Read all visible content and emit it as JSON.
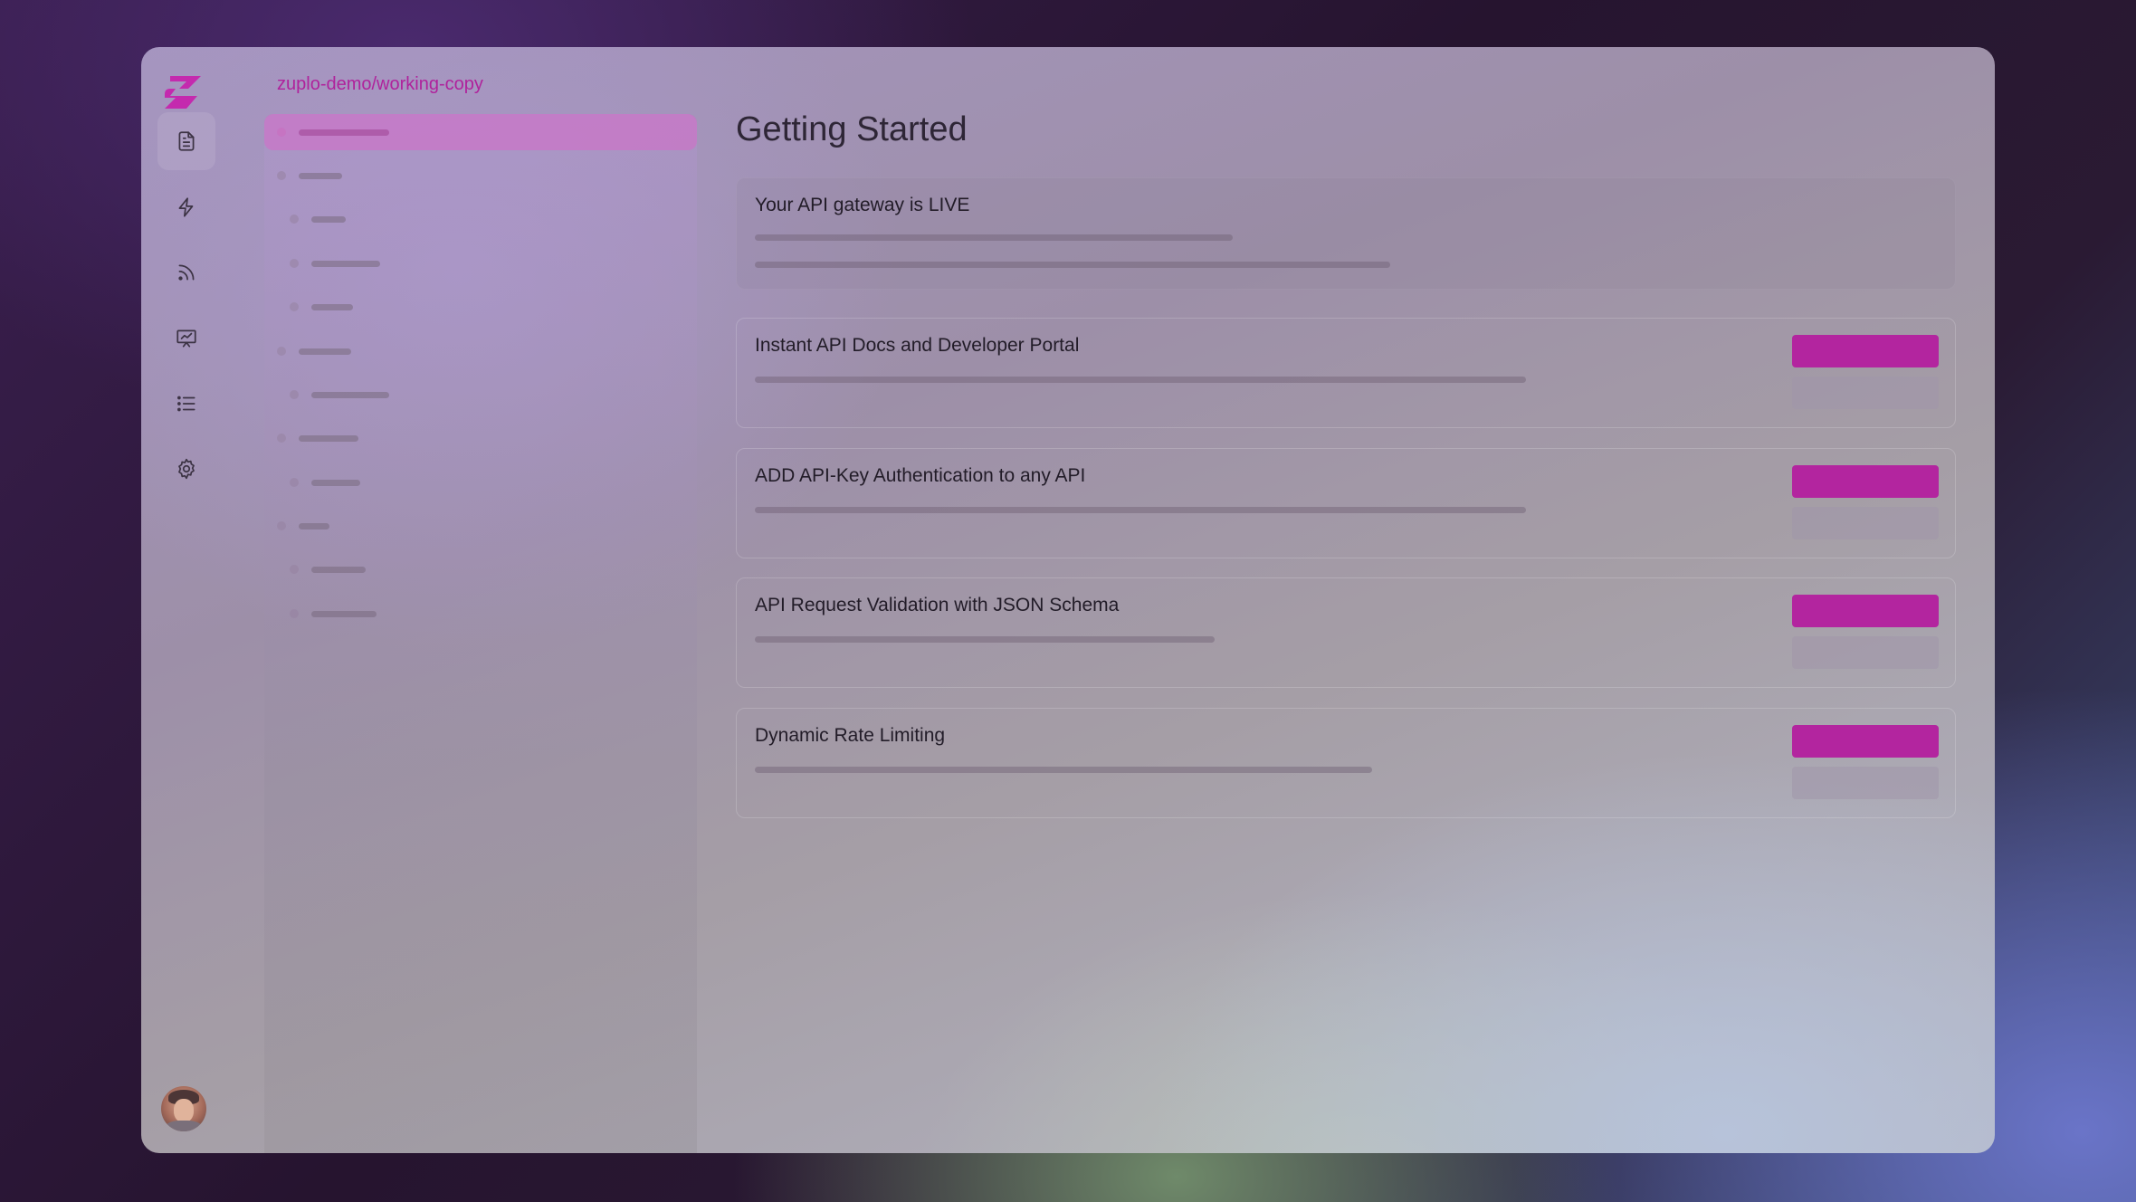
{
  "app": {
    "breadcrumb": "zuplo-demo/working-copy",
    "accent_color": "#b3259f"
  },
  "rail": {
    "items": [
      {
        "icon": "file-text-icon",
        "active": true
      },
      {
        "icon": "lightning-icon",
        "active": false
      },
      {
        "icon": "rss-icon",
        "active": false
      },
      {
        "icon": "presentation-chart-icon",
        "active": false
      },
      {
        "icon": "list-icon",
        "active": false
      },
      {
        "icon": "gear-icon",
        "active": false
      }
    ]
  },
  "main": {
    "title": "Getting Started",
    "live_card": {
      "title": "Your API gateway is LIVE"
    },
    "tasks": [
      {
        "title": "Instant API Docs and Developer Portal"
      },
      {
        "title": "ADD API-Key Authentication to any API"
      },
      {
        "title": "API Request Validation with JSON Schema"
      },
      {
        "title": "Dynamic Rate Limiting"
      }
    ]
  }
}
